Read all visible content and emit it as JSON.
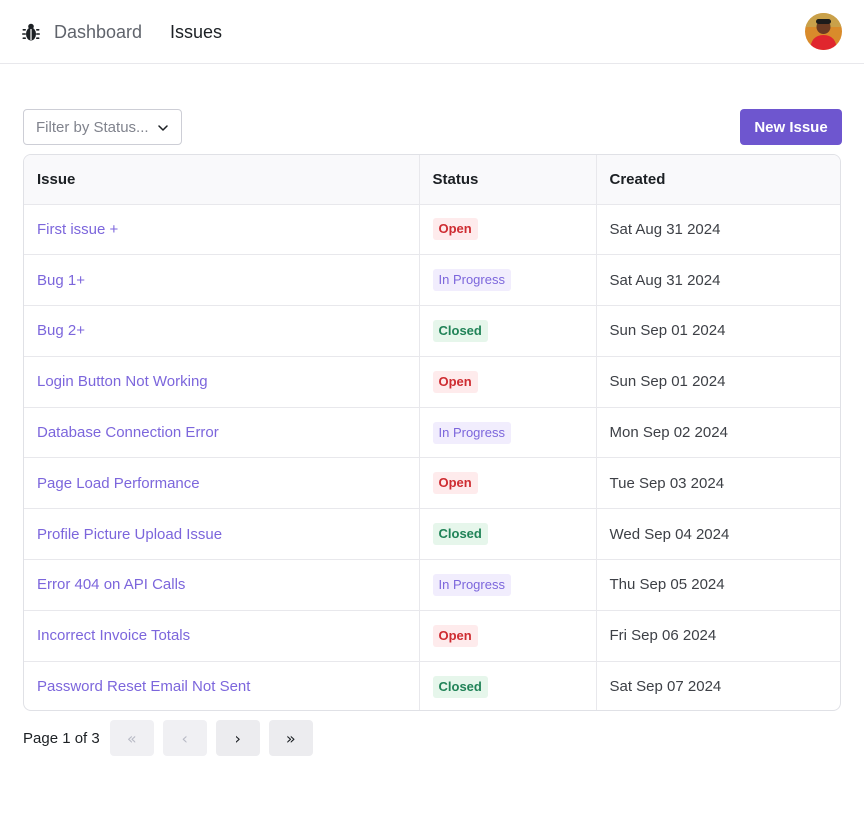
{
  "nav": {
    "logo_icon": "bug-icon",
    "links": {
      "dashboard": "Dashboard",
      "issues": "Issues"
    },
    "avatar_icon": "user-avatar"
  },
  "toolbar": {
    "filter_placeholder": "Filter by Status...",
    "new_issue_label": "New Issue"
  },
  "table": {
    "headers": {
      "issue": "Issue",
      "status": "Status",
      "created": "Created"
    },
    "rows": [
      {
        "title": "First issue +",
        "status": "Open",
        "created": "Sat Aug 31 2024"
      },
      {
        "title": "Bug 1+",
        "status": "In Progress",
        "created": "Sat Aug 31 2024"
      },
      {
        "title": "Bug 2+",
        "status": "Closed",
        "created": "Sun Sep 01 2024"
      },
      {
        "title": "Login Button Not Working",
        "status": "Open",
        "created": "Sun Sep 01 2024"
      },
      {
        "title": "Database Connection Error",
        "status": "In Progress",
        "created": "Mon Sep 02 2024"
      },
      {
        "title": "Page Load Performance",
        "status": "Open",
        "created": "Tue Sep 03 2024"
      },
      {
        "title": "Profile Picture Upload Issue",
        "status": "Closed",
        "created": "Wed Sep 04 2024"
      },
      {
        "title": "Error 404 on API Calls",
        "status": "In Progress",
        "created": "Thu Sep 05 2024"
      },
      {
        "title": "Incorrect Invoice Totals",
        "status": "Open",
        "created": "Fri Sep 06 2024"
      },
      {
        "title": "Password Reset Email Not Sent",
        "status": "Closed",
        "created": "Sat Sep 07 2024"
      }
    ]
  },
  "pagination": {
    "label": "Page 1 of 3",
    "buttons": [
      "first-page-icon",
      "previous-page-icon",
      "next-page-icon",
      "last-page-icon"
    ]
  },
  "colors": {
    "accent": "#6e56cf",
    "link": "#7c66dc",
    "open": "#ce2c31",
    "in_progress": "#7c66dc",
    "closed": "#218358"
  }
}
